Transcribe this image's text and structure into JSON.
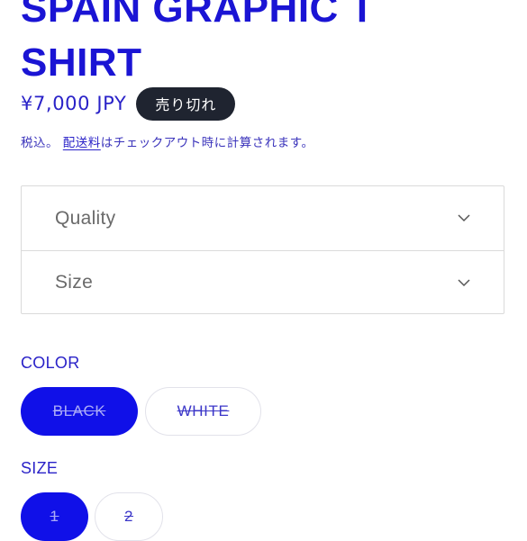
{
  "product": {
    "title_line1": "SPAIN GRAPHIC T",
    "title_line2": "SHIRT",
    "price": "¥7,000 JPY",
    "badge": "売り切れ",
    "tax_prefix": "税込。",
    "shipping_link": "配送料",
    "tax_suffix": "はチェックアウト時に計算されます。"
  },
  "accordion": [
    {
      "label": "Quality",
      "icon": "chevron-down-icon"
    },
    {
      "label": "Size",
      "icon": "chevron-down-icon"
    }
  ],
  "color_option": {
    "label": "COLOR",
    "values": [
      "BLACK",
      "WHITE"
    ],
    "selected": "BLACK"
  },
  "size_option": {
    "label": "SIZE",
    "values": [
      "1",
      "2"
    ],
    "selected": "1"
  },
  "colors": {
    "accent": "#1010e8",
    "text_blue": "#2a22c8",
    "badge_bg": "#1f2430"
  }
}
